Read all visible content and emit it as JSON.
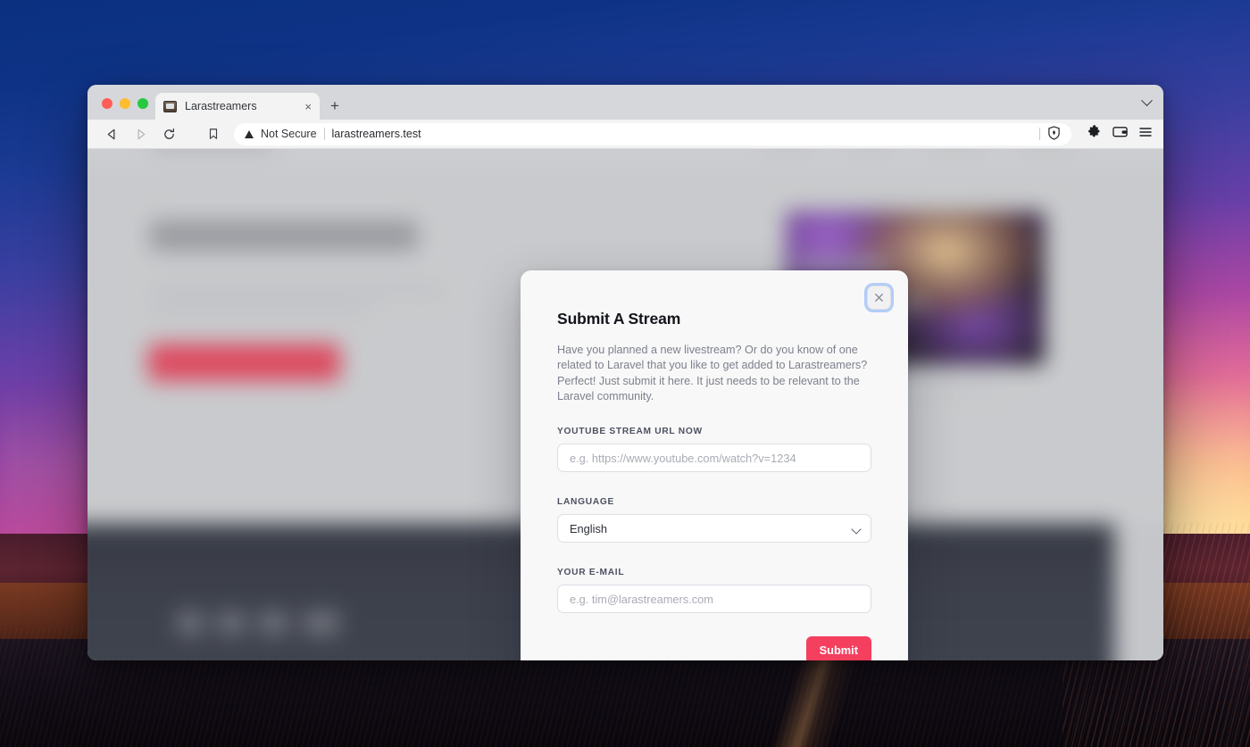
{
  "browser": {
    "traffic_lights": [
      "close",
      "minimize",
      "maximize"
    ],
    "tab": {
      "title": "Larastreamers",
      "favicon": "monitor-icon",
      "close_label": "×"
    },
    "new_tab_label": "+",
    "tab_list_icon": "chevron-down-icon",
    "nav": {
      "back_icon": "back-arrow-icon",
      "forward_icon": "forward-arrow-icon",
      "reload_icon": "reload-icon",
      "bookmark_icon": "bookmark-icon"
    },
    "omnibox": {
      "security_icon": "warning-triangle-icon",
      "security_label": "Not Secure",
      "url": "larastreamers.test",
      "shield_icon": "brave-shield-icon"
    },
    "toolbar_right": [
      {
        "name": "extensions-icon",
        "glyph": "puzzle"
      },
      {
        "name": "wallet-icon",
        "glyph": "wallet"
      },
      {
        "name": "menu-icon",
        "glyph": "hamburger"
      }
    ]
  },
  "modal": {
    "title": "Submit A Stream",
    "description": "Have you planned a new livestream? Or do you know of one related to Laravel that you like to get added to Larastreamers? Perfect! Just submit it here. It just needs to be relevant to the Laravel community.",
    "close_icon": "close-x-icon",
    "fields": {
      "url": {
        "label": "YOUTUBE STREAM URL NOW",
        "value": "",
        "placeholder": "e.g. https://www.youtube.com/watch?v=1234"
      },
      "language": {
        "label": "LANGUAGE",
        "value": "English",
        "options": [
          "English"
        ],
        "chevron_icon": "chevron-down-icon"
      },
      "email": {
        "label": "YOUR E-MAIL",
        "value": "",
        "placeholder": "e.g. tim@larastreamers.com"
      }
    },
    "submit_label": "Submit",
    "accent_color": "#f43f5e",
    "surface_color": "#f8f8f9",
    "focus_ring_color": "#76a9fa"
  }
}
